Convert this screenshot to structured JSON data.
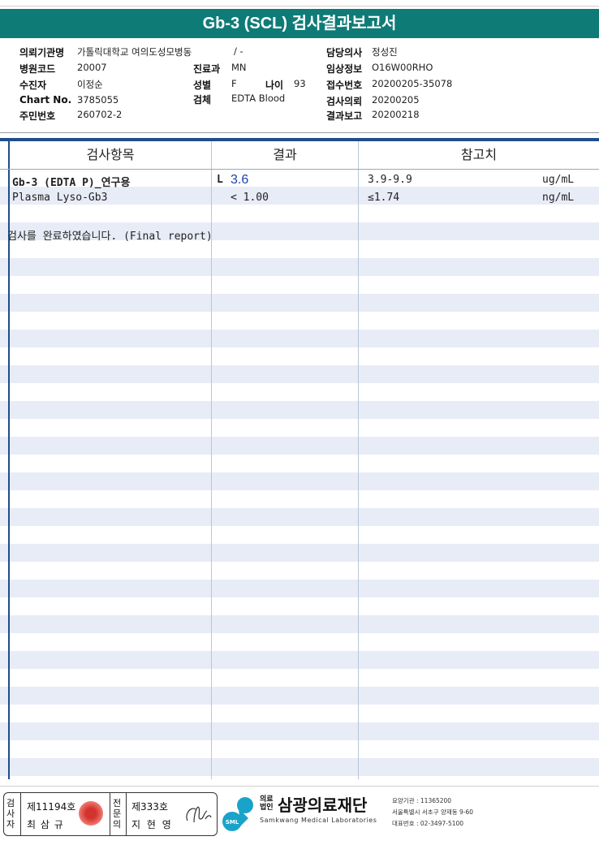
{
  "title": "Gb-3 (SCL) 검사결과보고서",
  "patient": {
    "institution_label": "의뢰기관명",
    "institution_value": "가톨릭대학교 여의도성모병동",
    "ward_value": "/ -",
    "doctor_label": "담당의사",
    "doctor_value": "정성진",
    "hospital_code_label": "병원코드",
    "hospital_code_value": "20007",
    "dept_label": "진료과",
    "dept_value": "MN",
    "clinical_label": "임상정보",
    "clinical_value": "O16W00RHO",
    "collector_label": "수진자",
    "collector_value": "이정순",
    "sex_label": "성별",
    "sex_value": "F",
    "age_label": "나이",
    "age_value": "93",
    "receipt_label": "접수번호",
    "receipt_value": "20200205-35078",
    "chart_label": "Chart No.",
    "chart_value": "3785055",
    "specimen_label": "검체",
    "specimen_value": "EDTA Blood",
    "request_label": "검사의뢰",
    "request_value": "20200205",
    "id_label": "주민번호",
    "id_value": "260702-2",
    "report_label": "결과보고",
    "report_value": "20200218"
  },
  "table": {
    "headers": {
      "item": "검사항목",
      "result": "결과",
      "reference": "참고치"
    },
    "rows": [
      {
        "item": "Gb-3 (EDTA P)_연구용",
        "flag": "L",
        "result": "3.6",
        "reference": "3.9-9.9",
        "unit": "ug/mL"
      },
      {
        "item": "Plasma Lyso-Gb3",
        "flag": "",
        "result": "< 1.00",
        "reference": "≤1.74",
        "unit": "ng/mL"
      }
    ],
    "note": "검사를 완료하였습니다. (Final report)"
  },
  "footer": {
    "tester_label": "검사자",
    "tester_no": "제11194호",
    "tester_name": "최 삼 규",
    "specialist_label": "전문의",
    "specialist_no": "제333호",
    "specialist_name": "지 현 영",
    "brand_prefix": "의료법인",
    "brand_name": "삼광의료재단",
    "brand_en": "Samkwang Medical Laboratories",
    "logo_text": "SML",
    "care_code": "요양기관 : 11365200",
    "address": "서울특별시 서초구 양재동 9-60",
    "phone": "대표번호 : 02-3497-5100"
  },
  "colors": {
    "title_bg": "#0f7b77",
    "stripe": "#e7ecf6",
    "low_flag": "#1a3fb0"
  }
}
